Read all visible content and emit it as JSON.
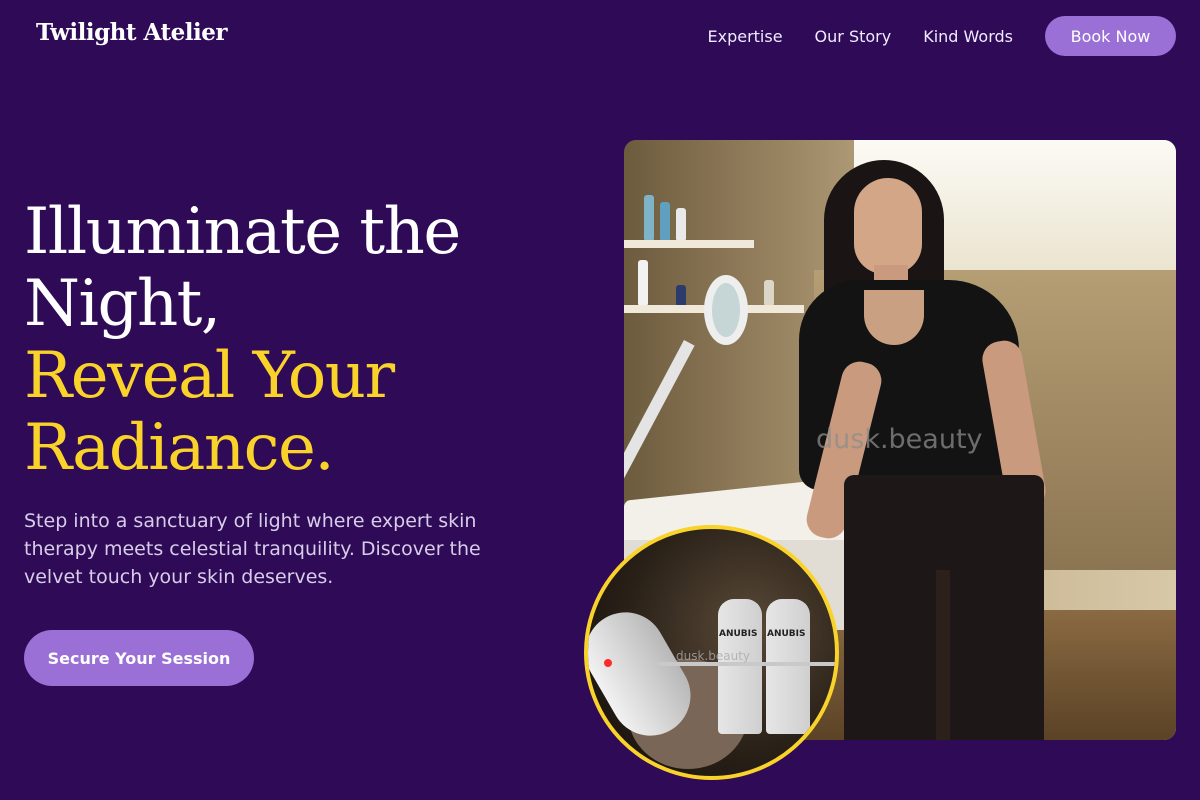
{
  "brand": {
    "name": "Twilight Atelier"
  },
  "nav": {
    "links": [
      "Expertise",
      "Our Story",
      "Kind Words"
    ],
    "cta": "Book Now"
  },
  "hero": {
    "headline_lines": [
      "Illuminate the",
      "Night,",
      "Reveal Your",
      "Radiance."
    ],
    "subtitle": "Step into a sanctuary of light where expert skin therapy meets celestial tranquility. Discover the velvet touch your skin deserves.",
    "cta": "Secure Your Session"
  },
  "images": {
    "main_watermark": "dusk.beauty",
    "inset_watermark": "dusk.beauty",
    "inset_bottle_label": "ANUBIS"
  },
  "colors": {
    "background": "#2e0a57",
    "accent_yellow": "#f9d22a",
    "button_purple": "#9a6fd6"
  }
}
